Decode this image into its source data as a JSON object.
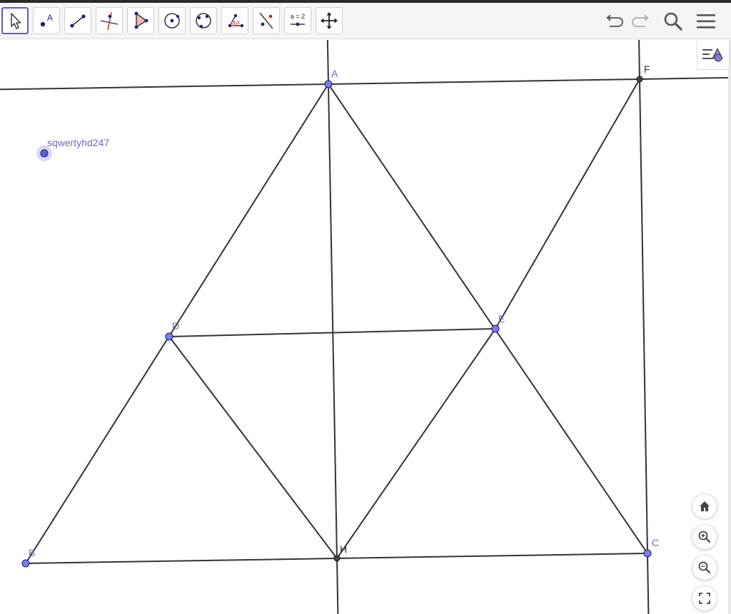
{
  "colors": {
    "accent": "#6557d2",
    "point_fill": "#7b7ee8",
    "point_stroke": "#1a1a6e",
    "line": "#333333",
    "label_blue": "#6b6bc4",
    "label_dark": "#333333"
  },
  "toolbar": {
    "tools": [
      {
        "name": "move-tool",
        "icon": "arrow-cursor-icon"
      },
      {
        "name": "point-tool",
        "icon": "point-a-icon",
        "glyph": "A"
      },
      {
        "name": "segment-tool",
        "icon": "segment-icon"
      },
      {
        "name": "perpendicular-line-tool",
        "icon": "perpendicular-line-icon"
      },
      {
        "name": "polygon-tool",
        "icon": "polygon-icon"
      },
      {
        "name": "circle-center-point-tool",
        "icon": "circle-center-icon"
      },
      {
        "name": "circle-three-points-tool",
        "icon": "circle-three-points-icon"
      },
      {
        "name": "angle-tool",
        "icon": "angle-icon",
        "glyph": "α"
      },
      {
        "name": "reflect-tool",
        "icon": "reflect-icon"
      },
      {
        "name": "slider-tool",
        "icon": "slider-icon",
        "glyph": "a = 2"
      },
      {
        "name": "move-graphics-view-tool",
        "icon": "move-arrows-icon"
      }
    ],
    "right": [
      "undo-icon",
      "redo-icon",
      "search-icon",
      "menu-icon"
    ]
  },
  "graphics": {
    "points": {
      "A": {
        "label": "A",
        "style": "free"
      },
      "B": {
        "label": "B",
        "style": "free"
      },
      "C": {
        "label": "C",
        "style": "free"
      },
      "D": {
        "label": "D",
        "style": "free"
      },
      "E": {
        "label": "E",
        "style": "free"
      },
      "F": {
        "label": "F",
        "style": "dependent"
      },
      "H": {
        "label": "H",
        "style": "dependent"
      },
      "S": {
        "label": "sqwertyhd247",
        "style": "selected"
      }
    },
    "segments": [
      [
        "A",
        "B"
      ],
      [
        "B",
        "C"
      ],
      [
        "C",
        "A"
      ],
      [
        "D",
        "E"
      ],
      [
        "D",
        "H"
      ],
      [
        "E",
        "H"
      ],
      [
        "E",
        "F"
      ]
    ],
    "lines": [
      [
        "A",
        "F"
      ],
      [
        "A",
        "H"
      ],
      [
        "F",
        "C"
      ]
    ]
  },
  "zoom_controls": [
    "home-icon",
    "zoom-in-icon",
    "zoom-out-icon",
    "fullscreen-icon"
  ]
}
